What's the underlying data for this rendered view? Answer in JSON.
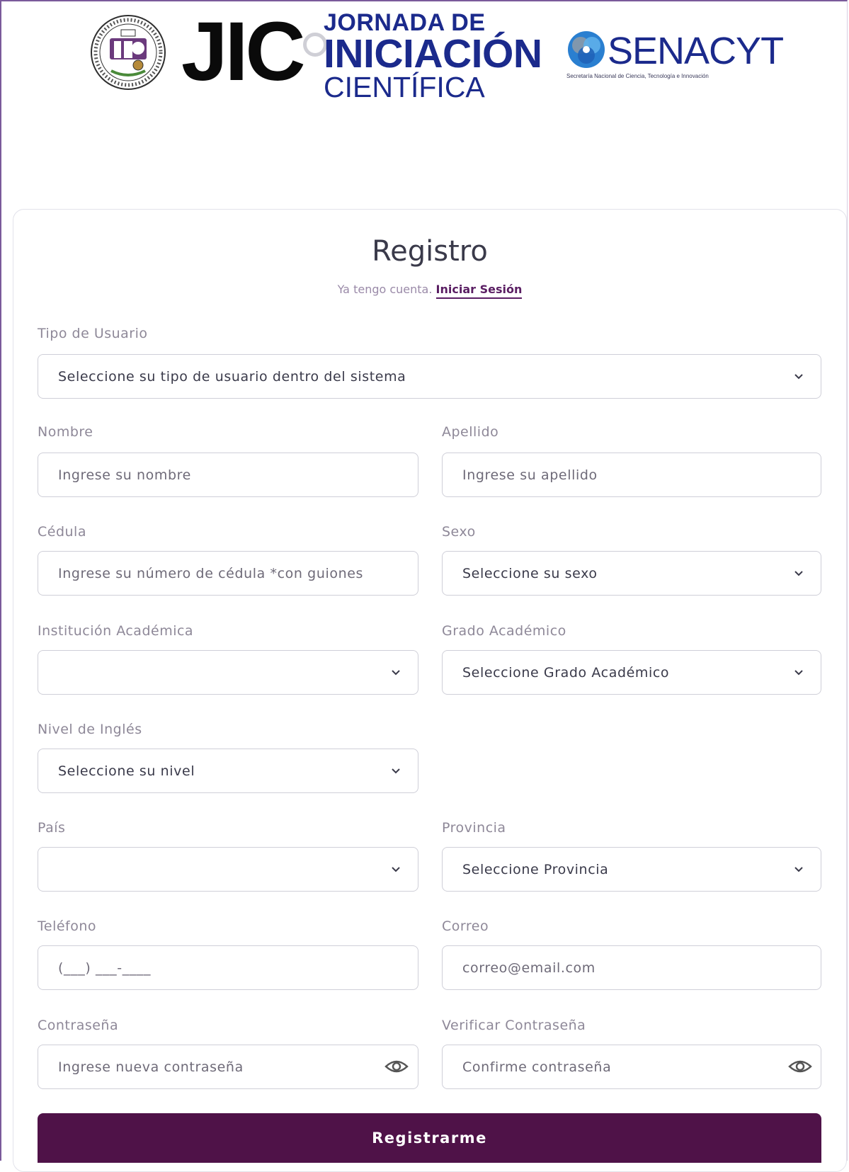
{
  "header": {
    "utp_seal_alt": "UTP",
    "jic_logo": "JIC",
    "jic_line1": "JORNADA DE",
    "jic_line2": "INICIACIÓN",
    "jic_line3": "CIENTÍFICA",
    "senacyt_logo": "SENACYT",
    "senacyt_subtitle": "Secretaría Nacional de Ciencia, Tecnología e Innovación"
  },
  "form": {
    "title": "Registro",
    "have_account_text": "Ya tengo cuenta.",
    "login_link": "Iniciar Sesión",
    "tipo_usuario": {
      "label": "Tipo de Usuario",
      "value": "Seleccione su tipo de usuario dentro del sistema"
    },
    "nombre": {
      "label": "Nombre",
      "placeholder": "Ingrese su nombre"
    },
    "apellido": {
      "label": "Apellido",
      "placeholder": "Ingrese su apellido"
    },
    "cedula": {
      "label": "Cédula",
      "placeholder": "Ingrese su número de cédula *con guiones"
    },
    "sexo": {
      "label": "Sexo",
      "value": "Seleccione su sexo"
    },
    "institucion": {
      "label": "Institución Académica",
      "value": ""
    },
    "grado": {
      "label": "Grado Académico",
      "value": "Seleccione Grado Académico"
    },
    "ingles": {
      "label": "Nivel de Inglés",
      "value": "Seleccione su nivel"
    },
    "pais": {
      "label": "País",
      "value": ""
    },
    "provincia": {
      "label": "Provincia",
      "value": "Seleccione Provincia"
    },
    "telefono": {
      "label": "Teléfono",
      "placeholder": "(___) ___-____"
    },
    "correo": {
      "label": "Correo",
      "placeholder": "correo@email.com"
    },
    "contrasena": {
      "label": "Contraseña",
      "placeholder": "Ingrese nueva contraseña"
    },
    "verificar": {
      "label": "Verificar Contraseña",
      "placeholder": "Confirme contraseña"
    },
    "submit_label": "Registrarme"
  },
  "colors": {
    "brand_purple": "#4f1248",
    "logo_blue": "#1b2a8c",
    "label_gray": "#8e8898",
    "border": "#cfcfd8"
  },
  "icons": [
    "chevron-down-icon",
    "eye-icon",
    "utp-seal-logo",
    "senacyt-logo-icon"
  ]
}
